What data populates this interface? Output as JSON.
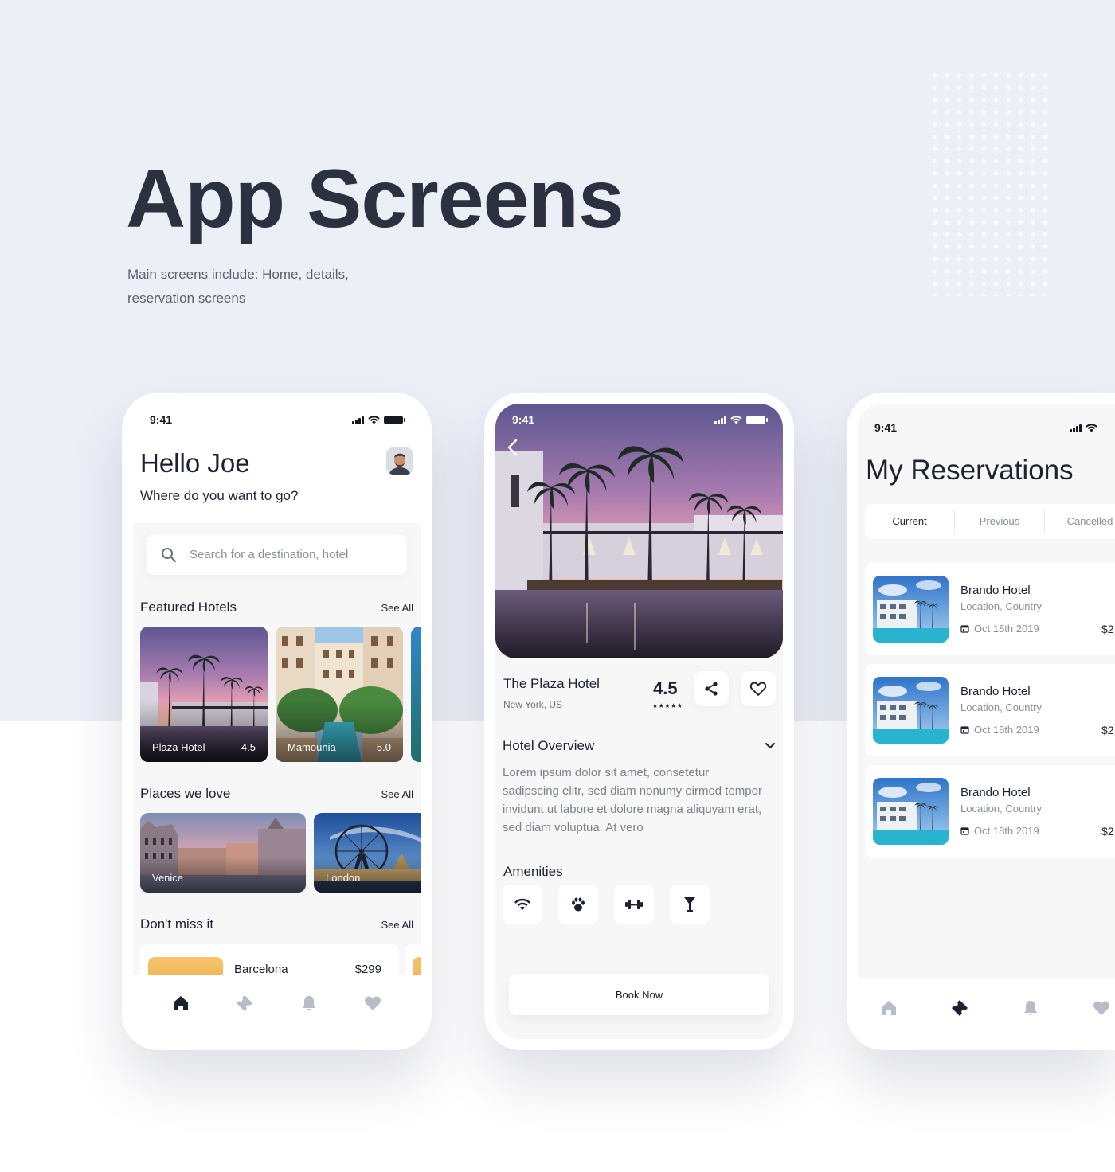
{
  "hero": {
    "title": "App Screens",
    "subtitle": "Main screens include: Home, details, reservation screens"
  },
  "home": {
    "status_time": "9:41",
    "greeting": "Hello Joe",
    "prompt": "Where do you want to go?",
    "search_placeholder": "Search for a destination, hotel",
    "featured": {
      "title": "Featured Hotels",
      "see_all": "See All",
      "hotels": [
        {
          "name": "Plaza Hotel",
          "rating": "4.5"
        },
        {
          "name": "Mamounia",
          "rating": "5.0"
        }
      ]
    },
    "places": {
      "title": "Places we love",
      "see_all": "See All",
      "items": [
        {
          "name": "Venice"
        },
        {
          "name": "London"
        }
      ]
    },
    "dont_miss": {
      "title": "Don't miss it",
      "see_all": "See All",
      "items": [
        {
          "name": "Barcelona",
          "price": "$299"
        }
      ]
    },
    "tabs": [
      "home-icon",
      "ticket-icon",
      "bell-icon",
      "heart-icon"
    ],
    "active_tab": "home-icon"
  },
  "details": {
    "status_time": "9:41",
    "hotel_name": "The Plaza Hotel",
    "location": "New York, US",
    "rating": "4.5",
    "stars": "★★★★★",
    "overview_title": "Hotel Overview",
    "overview_text": "Lorem ipsum dolor sit amet, consetetur sadipscing elitr, sed diam nonumy eirmod tempor invidunt ut labore et dolore magna aliquyam erat, sed diam voluptua. At vero",
    "amenities_title": "Amenities",
    "amenities": [
      "wifi-icon",
      "paw-icon",
      "dumbbell-icon",
      "cocktail-icon"
    ],
    "book_label": "Book Now"
  },
  "reservations": {
    "status_time": "9:41",
    "title": "My Reservations",
    "segments": [
      "Current",
      "Previous",
      "Cancelled"
    ],
    "active_segment": "Current",
    "items": [
      {
        "name": "Brando Hotel",
        "location": "Location, Country",
        "date": "Oct 18th 2019",
        "price": "$2"
      },
      {
        "name": "Brando Hotel",
        "location": "Location, Country",
        "date": "Oct 18th 2019",
        "price": "$2"
      },
      {
        "name": "Brando Hotel",
        "location": "Location, Country",
        "date": "Oct 18th 2019",
        "price": "$2"
      }
    ],
    "tabs": [
      "home-icon",
      "ticket-icon",
      "bell-icon",
      "heart-icon"
    ],
    "active_tab": "ticket-icon"
  },
  "colors": {
    "background": "#eceff6",
    "title": "#2b313f",
    "text": "#1d2230",
    "muted": "#8a8f99"
  }
}
